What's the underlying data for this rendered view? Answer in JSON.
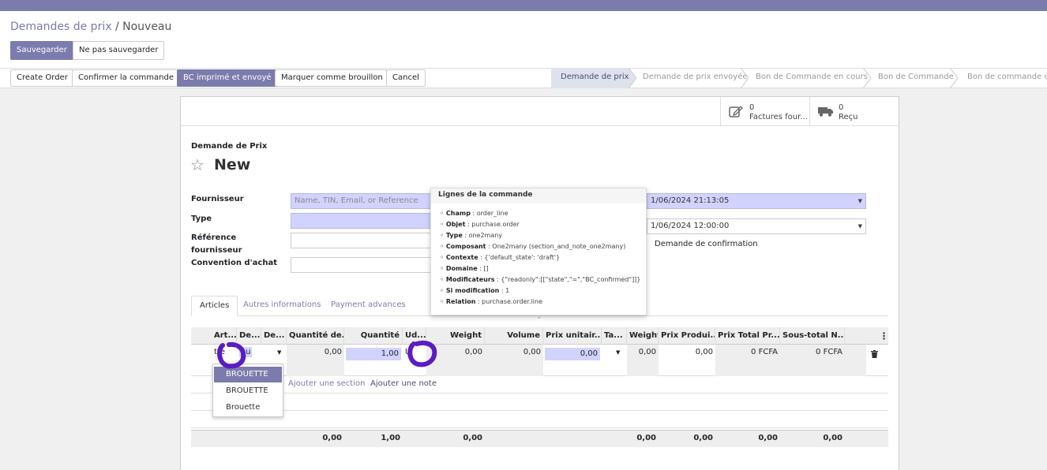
{
  "breadcrumb": {
    "parent": "Demandes de prix",
    "separator": "/",
    "current": "Nouveau"
  },
  "buttons": {
    "save": "Sauvegarder",
    "discard": "Ne pas sauvegarder",
    "create_order": "Create Order",
    "confirm": "Confirmer la commande",
    "printed_sent": "BC imprimé et envoyé",
    "mark_draft": "Marquer comme brouillon",
    "cancel": "Cancel"
  },
  "statusbar": [
    "Demande de prix",
    "Demande de prix envoyée",
    "Bon de Commande en cours",
    "Bon de Commande",
    "Bon de commande co"
  ],
  "smart_buttons": [
    {
      "count": "0",
      "label": "Factures four..."
    },
    {
      "count": "0",
      "label": "Reçu"
    }
  ],
  "form": {
    "doc_type": "Demande de Prix",
    "name": "New",
    "labels": {
      "supplier": "Fournisseur",
      "type": "Type",
      "ref_1": "Référence",
      "ref_2": "fournisseur",
      "agreement": "Convention d'achat"
    },
    "supplier_placeholder": "Name, TIN, Email, or Reference",
    "date_order": "1/06/2024 21:13:05",
    "date_planned": "1/06/2024 12:00:00",
    "confirm_request": "Demande de confirmation"
  },
  "tabs": [
    "Articles",
    "Autres informations",
    "Payment advances"
  ],
  "grid": {
    "headers": [
      "Art...",
      "De...",
      "De...",
      "Quantité de...",
      "Quantité",
      "Ud...",
      "Weight",
      "Volume",
      "Prix unitair...",
      "Ta...",
      "Weight",
      "Prix Produi...",
      "Prix Total Pr...",
      "Sous-total N..."
    ],
    "row": {
      "art": "tte",
      "desc": "ou",
      "qty_received": "0,00",
      "qty": "1,00",
      "uom": "U",
      "weight": "0,00",
      "volume": "0,00",
      "price_unit": "0,00",
      "weight2": "0,00",
      "price_product": "0,00",
      "price_total": "0 FCFA",
      "subtotal": "0 FCFA"
    },
    "add_section": "Ajouter une section",
    "add_note": "Ajouter une note",
    "totals": {
      "qty_received": "0,00",
      "qty": "1,00",
      "weight": "0,00",
      "weight2": "0,00",
      "price_product": "0,00",
      "price_total": "0,00",
      "subtotal": "0,00"
    }
  },
  "tooltip": {
    "title": "Lignes de la commande",
    "lines": [
      {
        "key": "Champ",
        "value": "order_line"
      },
      {
        "key": "Objet",
        "value": "purchase.order"
      },
      {
        "key": "Type",
        "value": "one2many"
      },
      {
        "key": "Composant",
        "value": "One2many (section_and_note_one2many)"
      },
      {
        "key": "Contexte",
        "value": "{'default_state': 'draft'}"
      },
      {
        "key": "Domaine",
        "value": "[]"
      },
      {
        "key": "Modificateurs",
        "value": "{\"readonly\":[[\"state\",\"=\",\"BC_confirmed\"]]}"
      },
      {
        "key": "Si modification",
        "value": "1"
      },
      {
        "key": "Relation",
        "value": "purchase.order.line"
      }
    ]
  },
  "dropdown": [
    "BROUETTE",
    "BROUETTE",
    "Brouette"
  ],
  "icons": {
    "star": "star-icon",
    "invoice": "pencil-square-icon",
    "truck": "truck-icon",
    "trash": "trash-icon",
    "external": "external-link-icon",
    "more": "vertical-dots-icon"
  },
  "colors": {
    "brand": "#7c7bad",
    "required": "#d2d2ff",
    "highlight": "#5b1cc4"
  }
}
